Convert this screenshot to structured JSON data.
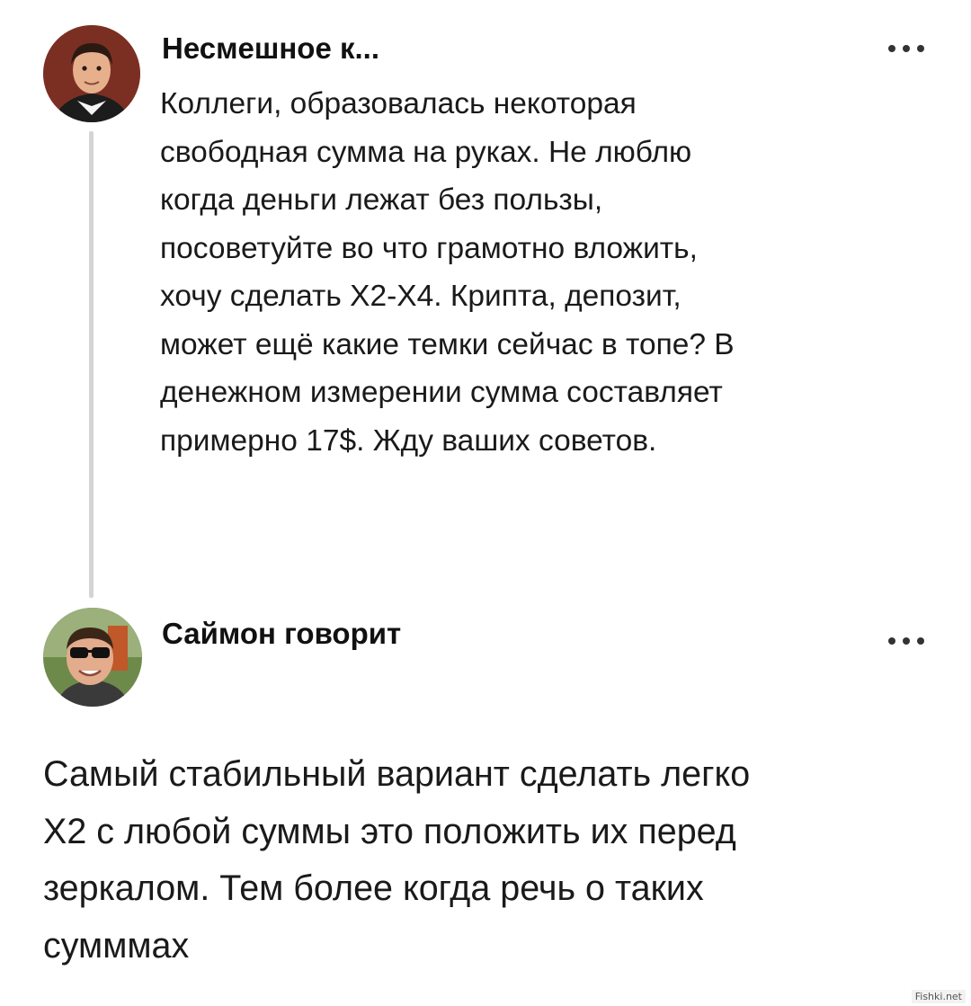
{
  "post": {
    "author": "Несмешное к...",
    "avatar_icon": "user-avatar-icon",
    "more_icon": "more-options-icon",
    "lines": [
      "Коллеги, образовалась некоторая",
      "свободная сумма на руках. Не люблю",
      "когда деньги лежат без пользы,",
      "посоветуйте во что грамотно вложить,",
      "хочу сделать Х2-Х4. Крипта, депозит,",
      "может ещё какие темки сейчас в топе? В",
      "денежном измерении сумма составляет",
      "примерно 17$. Жду ваших советов."
    ]
  },
  "reply": {
    "author": "Саймон говорит",
    "avatar_icon": "user-avatar-icon",
    "more_icon": "more-options-icon",
    "lines": [
      "Самый стабильный вариант сделать легко",
      "Х2 с любой суммы это положить их перед",
      "зеркалом. Тем более когда речь о таких",
      "сумммах"
    ]
  },
  "watermark": "Fishki.net",
  "colors": {
    "background": "#ffffff",
    "text": "#1a1a1a",
    "thread_line": "#d4d4d4"
  }
}
